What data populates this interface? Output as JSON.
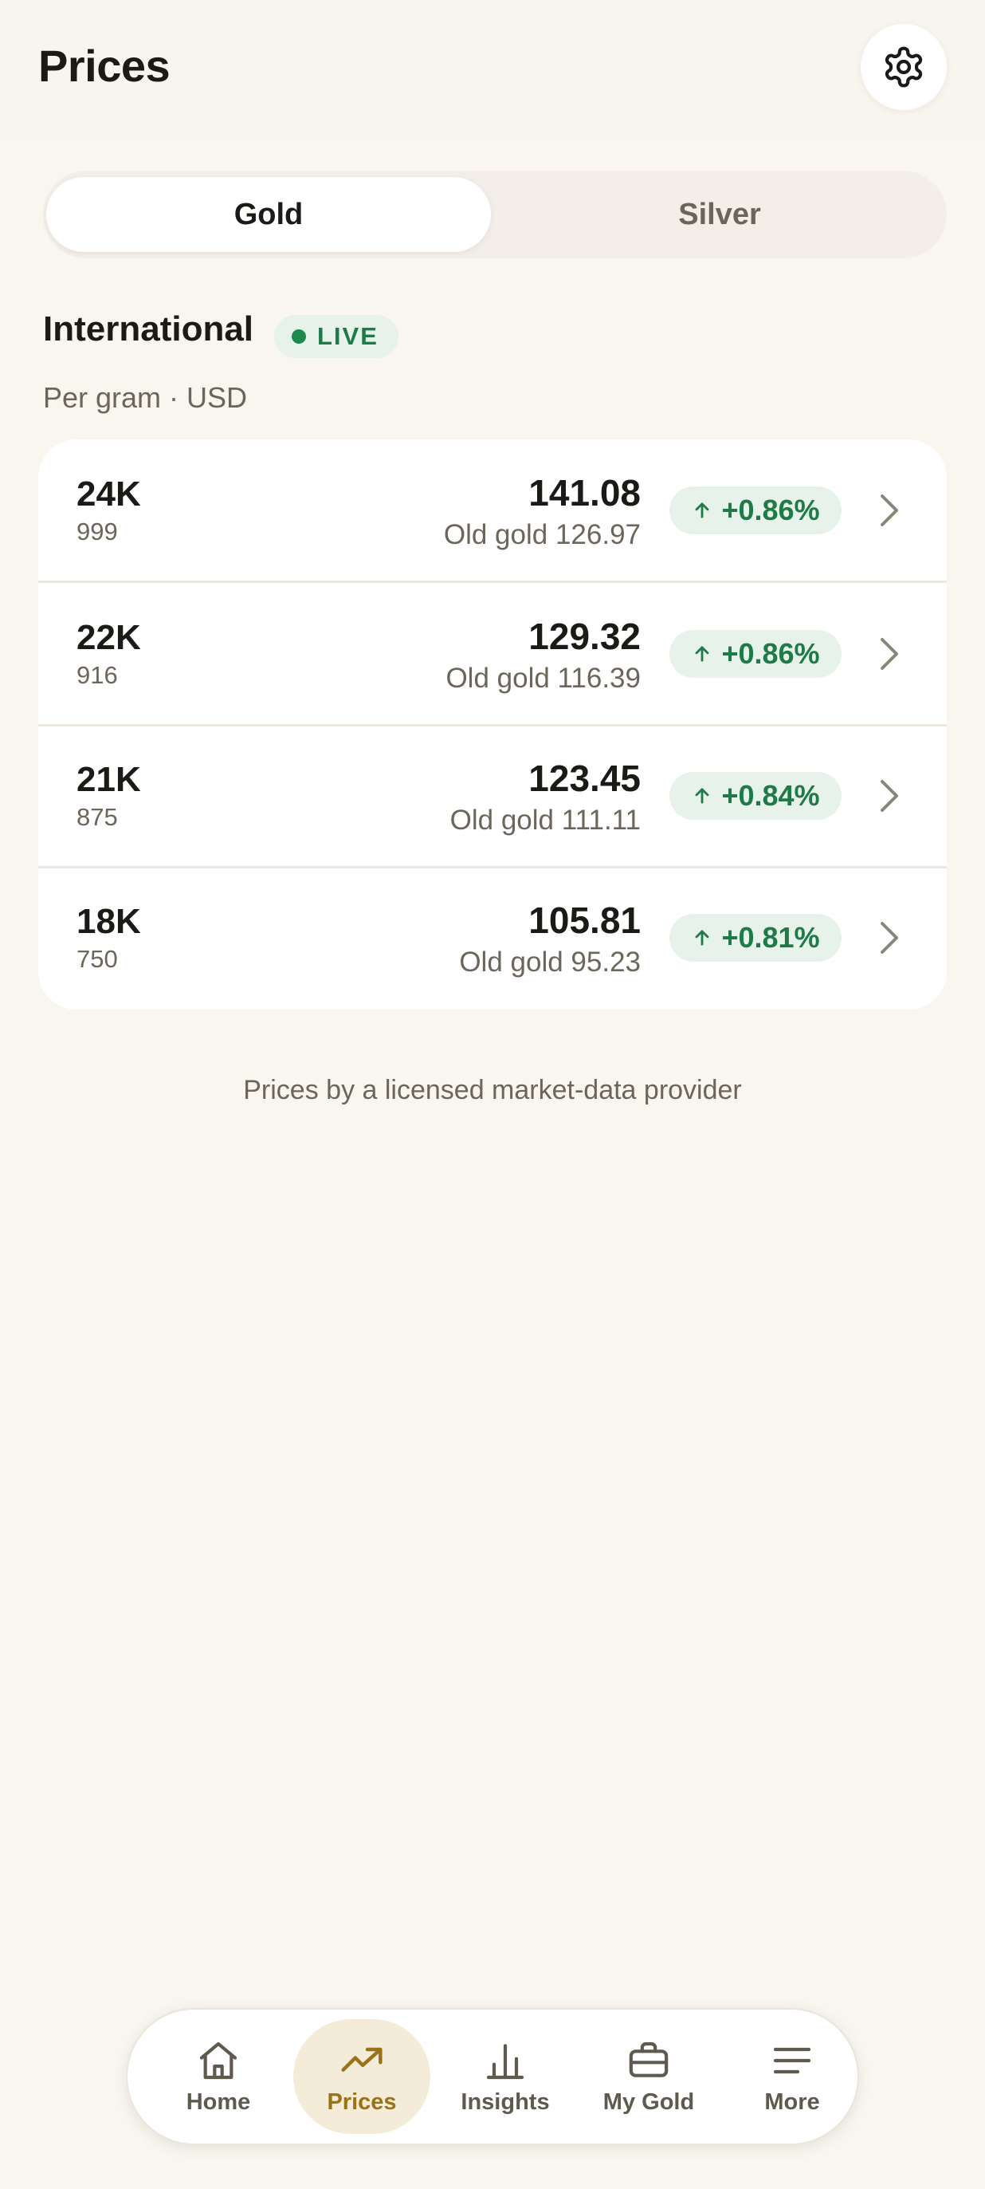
{
  "header": {
    "title": "Prices"
  },
  "metal_toggle": {
    "options": [
      "Gold",
      "Silver"
    ],
    "selected": "Gold"
  },
  "section": {
    "title": "International",
    "live_label": "LIVE",
    "unit": "Per gram · USD"
  },
  "prices": [
    {
      "karat": "24K",
      "purity": "999",
      "price": "141.08",
      "old_gold": "Old gold 126.97",
      "change": "+0.86%"
    },
    {
      "karat": "22K",
      "purity": "916",
      "price": "129.32",
      "old_gold": "Old gold 116.39",
      "change": "+0.86%"
    },
    {
      "karat": "21K",
      "purity": "875",
      "price": "123.45",
      "old_gold": "Old gold 111.11",
      "change": "+0.84%"
    },
    {
      "karat": "18K",
      "purity": "750",
      "price": "105.81",
      "old_gold": "Old gold 95.23",
      "change": "+0.81%"
    }
  ],
  "footer_note": "Prices by a licensed market-data provider",
  "nav": {
    "items": [
      {
        "label": "Home",
        "icon": "home-icon"
      },
      {
        "label": "Prices",
        "icon": "trending-up-icon"
      },
      {
        "label": "Insights",
        "icon": "bar-chart-icon"
      },
      {
        "label": "My Gold",
        "icon": "briefcase-icon"
      },
      {
        "label": "More",
        "icon": "menu-icon"
      }
    ],
    "active": "Prices"
  },
  "colors": {
    "background": "#f9f6f0",
    "accent": "#9a7218",
    "positive": "#1f7a47",
    "positive_bg": "#e6f2ea"
  }
}
